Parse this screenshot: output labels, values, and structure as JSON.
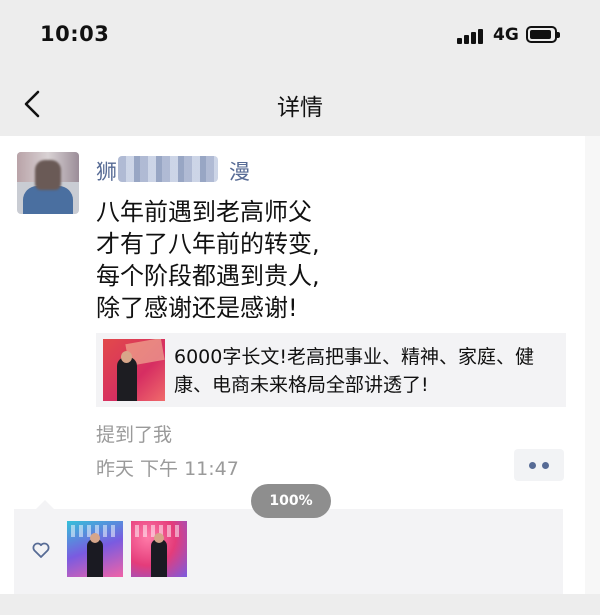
{
  "status_bar": {
    "time": "10:03",
    "network": "4G"
  },
  "nav": {
    "title": "详情"
  },
  "post": {
    "username_visible": "狮",
    "username_tail": "漫",
    "text_lines": [
      "八年前遇到老高师父",
      "才有了八年前的转变,",
      "每个阶段都遇到贵人,",
      "除了感谢还是感谢!"
    ],
    "share_card": {
      "title": "6000字长文!老高把事业、精神、家庭、健康、电商未来格局全部讲透了!"
    },
    "mention": "提到了我",
    "timestamp": "昨天 下午 11:47"
  },
  "zoom": "100%",
  "colors": {
    "link": "#576b95",
    "meta": "#9a9a9a",
    "card_bg": "#f3f3f5"
  },
  "icons": [
    "back-icon",
    "heart-icon",
    "more-dots-icon"
  ]
}
